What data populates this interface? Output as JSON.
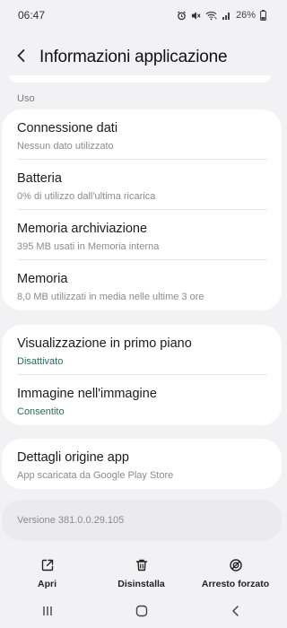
{
  "status_bar": {
    "time": "06:47",
    "battery_percent": "26%",
    "icons": [
      "alarm-icon",
      "mute-icon",
      "wifi-icon",
      "signal-icon",
      "battery-icon"
    ]
  },
  "header": {
    "title": "Informazioni applicazione",
    "back_icon": "back-arrow-icon"
  },
  "usage_section": {
    "label": "Uso",
    "items": [
      {
        "title": "Connessione dati",
        "subtitle": "Nessun dato utilizzato"
      },
      {
        "title": "Batteria",
        "subtitle": "0% di utilizzo dall'ultima ricarica"
      },
      {
        "title": "Memoria archiviazione",
        "subtitle": "395 MB usati in Memoria interna"
      },
      {
        "title": "Memoria",
        "subtitle": "8,0 MB utilizzati in media nelle ultime 3 ore"
      }
    ]
  },
  "permissions_section": {
    "items": [
      {
        "title": "Visualizzazione in primo piano",
        "subtitle": "Disattivato"
      },
      {
        "title": "Immagine nell'immagine",
        "subtitle": "Consentito"
      }
    ]
  },
  "store_section": {
    "title": "Dettagli origine app",
    "subtitle": "App scaricata da Google Play Store"
  },
  "version": "Versione 381.0.0.29.105",
  "actions": {
    "open": {
      "label": "Apri",
      "icon": "open-external-icon"
    },
    "uninstall": {
      "label": "Disinstalla",
      "icon": "trash-icon"
    },
    "force_stop": {
      "label": "Arresto forzato",
      "icon": "force-stop-icon"
    }
  },
  "colors": {
    "background": "#f2f2f4",
    "card": "#ffffff",
    "accent_subtitle": "#2a6b5a",
    "secondary_text": "#8b8b8e"
  }
}
